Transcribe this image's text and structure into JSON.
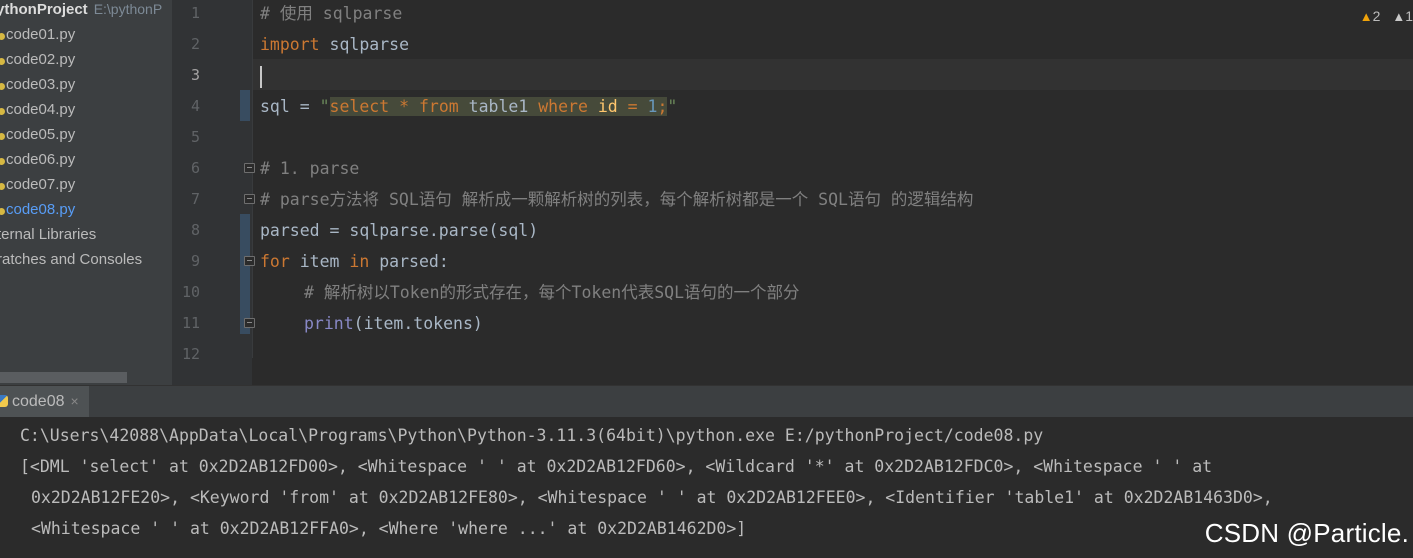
{
  "sidebar": {
    "project_name": "ythonProject",
    "project_path": "E:\\pythonP",
    "files": [
      "code01.py",
      "code02.py",
      "code03.py",
      "code04.py",
      "code05.py",
      "code06.py",
      "code07.py",
      "code08.py"
    ],
    "active_file": "code08.py",
    "external_libraries": "ternal Libraries",
    "scratches": "ratches and Consoles"
  },
  "editor": {
    "inspections": {
      "warnings": "2",
      "weak_warnings": "1"
    },
    "line_numbers": [
      "1",
      "2",
      "3",
      "4",
      "5",
      "6",
      "7",
      "8",
      "9",
      "10",
      "11",
      "12"
    ],
    "lines": {
      "l1": "# 使用 sqlparse",
      "l2_kw": "import",
      "l2_rest": " sqlparse",
      "l4_a": "sql = ",
      "l4_q1": "\"",
      "l4_select": "select",
      "l4_sp1": " ",
      "l4_star": "*",
      "l4_sp2": " ",
      "l4_from": "from",
      "l4_table": " table1 ",
      "l4_where": "where",
      "l4_sp3": " ",
      "l4_id": "id",
      "l4_sp4": " ",
      "l4_eq": "=",
      "l4_sp5": " ",
      "l4_num": "1",
      "l4_semi": ";",
      "l4_q2": "\"",
      "l6": "# 1. parse",
      "l7": "# parse方法将 SQL语句 解析成一颗解析树的列表，每个解析树都是一个 SQL语句 的逻辑结构",
      "l8": "parsed = sqlparse.parse(sql)",
      "l9_for": "for",
      "l9_item": " item ",
      "l9_in": "in",
      "l9_rest": " parsed:",
      "l10": "# 解析树以Token的形式存在，每个Token代表SQL语句的一个部分",
      "l11_print": "print",
      "l11_rest": "(item.tokens)"
    }
  },
  "run": {
    "tab_label": "code08",
    "close_glyph": "×",
    "console": [
      "C:\\Users\\42088\\AppData\\Local\\Programs\\Python\\Python-3.11.3(64bit)\\python.exe E:/pythonProject/code08.py",
      "[<DML 'select' at 0x2D2AB12FD00>, <Whitespace ' ' at 0x2D2AB12FD60>, <Wildcard '*' at 0x2D2AB12FDC0>, <Whitespace ' ' at",
      "0x2D2AB12FE20>, <Keyword 'from' at 0x2D2AB12FE80>, <Whitespace ' ' at 0x2D2AB12FEE0>, <Identifier 'table1' at 0x2D2AB1463D0>,",
      "<Whitespace ' ' at 0x2D2AB12FFA0>, <Where 'where ...' at 0x2D2AB1462D0>]"
    ]
  },
  "watermark": "CSDN @Particle.",
  "colors": {
    "keyword": "#cc7832",
    "comment": "#808080",
    "string": "#6a8759",
    "number": "#6897bb",
    "builtin": "#8888c6",
    "active_file": "#589df6"
  },
  "icons": [
    "python-file-icon",
    "python-run-icon",
    "warning-icon",
    "weak-warning-icon",
    "fold-icon",
    "close-icon"
  ]
}
